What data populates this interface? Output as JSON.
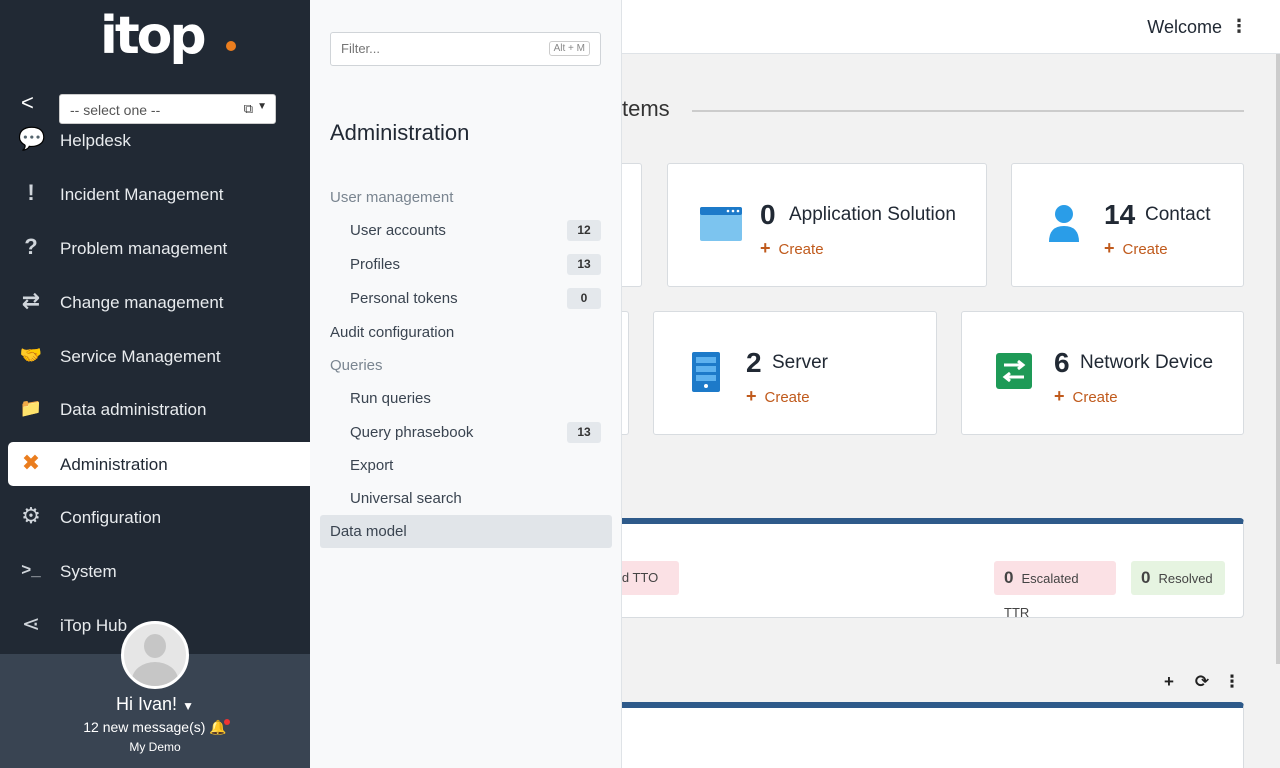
{
  "topbar": {
    "welcome": "Welcome",
    "menu_icon": "⋮"
  },
  "main": {
    "section_title": "tems",
    "cards": [
      {
        "count": "0",
        "name": "Application Solution",
        "create": "Create",
        "icon": "application-window-icon"
      },
      {
        "count": "14",
        "name": "Contact",
        "create": "Create",
        "icon": "person-icon"
      },
      {
        "count": "2",
        "name": "Server",
        "create": "Create",
        "icon": "server-icon"
      },
      {
        "count": "6",
        "name": "Network Device",
        "create": "Create",
        "icon": "network-device-icon"
      }
    ],
    "pills": [
      {
        "count": "",
        "label": "ted TTO"
      },
      {
        "count": "0",
        "label": "Escalated TTR"
      },
      {
        "count": "0",
        "label": "Resolved"
      }
    ],
    "toolbar": {
      "add": "+",
      "refresh": "⟳",
      "more": "⋮"
    }
  },
  "sidebar": {
    "logo": "itop",
    "collapse": "<",
    "org_select": {
      "value": "-- select one --"
    },
    "items": [
      {
        "label": "Helpdesk",
        "icon": "speech-bubble-icon",
        "glyph": "💬"
      },
      {
        "label": "Incident Management",
        "icon": "exclamation-icon",
        "glyph": "!"
      },
      {
        "label": "Problem management",
        "icon": "question-icon",
        "glyph": "?"
      },
      {
        "label": "Change management",
        "icon": "exchange-arrows-icon",
        "glyph": "⇄"
      },
      {
        "label": "Service Management",
        "icon": "handshake-icon",
        "glyph": "🤝"
      },
      {
        "label": "Data administration",
        "icon": "folder-icon",
        "glyph": "📁"
      },
      {
        "label": "Administration",
        "icon": "tools-icon",
        "glyph": "✖"
      },
      {
        "label": "Configuration",
        "icon": "gear-icon",
        "glyph": "⚙"
      },
      {
        "label": "System",
        "icon": "terminal-icon",
        "glyph": ">_"
      },
      {
        "label": "iTop Hub",
        "icon": "share-icon",
        "glyph": "⋖"
      }
    ],
    "user": {
      "greeting": "Hi Ivan!",
      "messages": "12 new message(s)",
      "org": "My Demo"
    }
  },
  "flyout": {
    "filter_placeholder": "Filter...",
    "filter_hint": "Alt + M",
    "title": "Administration",
    "groups": {
      "user_management": "User management",
      "user_accounts": {
        "label": "User accounts",
        "count": "12"
      },
      "profiles": {
        "label": "Profiles",
        "count": "13"
      },
      "personal_tokens": {
        "label": "Personal tokens",
        "count": "0"
      },
      "audit_configuration": "Audit configuration",
      "queries": "Queries",
      "run_queries": "Run queries",
      "query_phrasebook": {
        "label": "Query phrasebook",
        "count": "13"
      },
      "export": "Export",
      "universal_search": "Universal search",
      "data_model": "Data model"
    }
  }
}
